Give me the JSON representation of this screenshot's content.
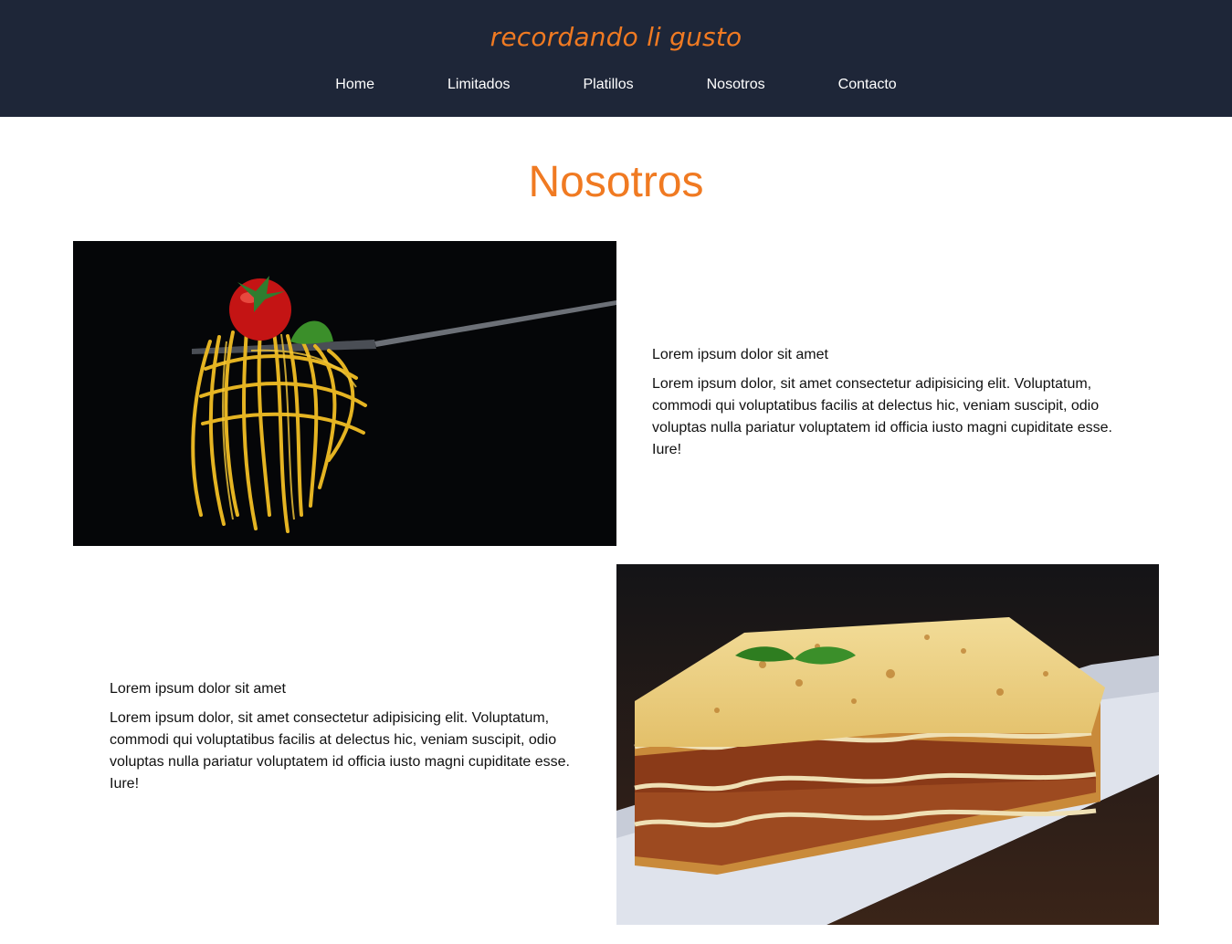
{
  "header": {
    "brand": "recordando li gusto",
    "nav": [
      "Home",
      "Limitados",
      "Platillos",
      "Nosotros",
      "Contacto"
    ]
  },
  "main": {
    "title": "Nosotros",
    "features": [
      {
        "image_icon": "spaghetti-fork-photo",
        "heading": "Lorem ipsum dolor sit amet",
        "body": "Lorem ipsum dolor, sit amet consectetur adipisicing elit. Voluptatum, commodi qui voluptatibus facilis at delectus hic, veniam suscipit, odio voluptas nulla pariatur voluptatem id officia iusto magni cupiditate esse. Iure!"
      },
      {
        "image_icon": "lasagna-photo",
        "heading": "Lorem ipsum dolor sit amet",
        "body": "Lorem ipsum dolor, sit amet consectetur adipisicing elit. Voluptatum, commodi qui voluptatibus facilis at delectus hic, veniam suscipit, odio voluptas nulla pariatur voluptatem id officia iusto magni cupiditate esse. Iure!"
      }
    ]
  },
  "colors": {
    "header_bg": "#1e2638",
    "accent": "#f07a22",
    "nav_text": "#ffffff"
  }
}
